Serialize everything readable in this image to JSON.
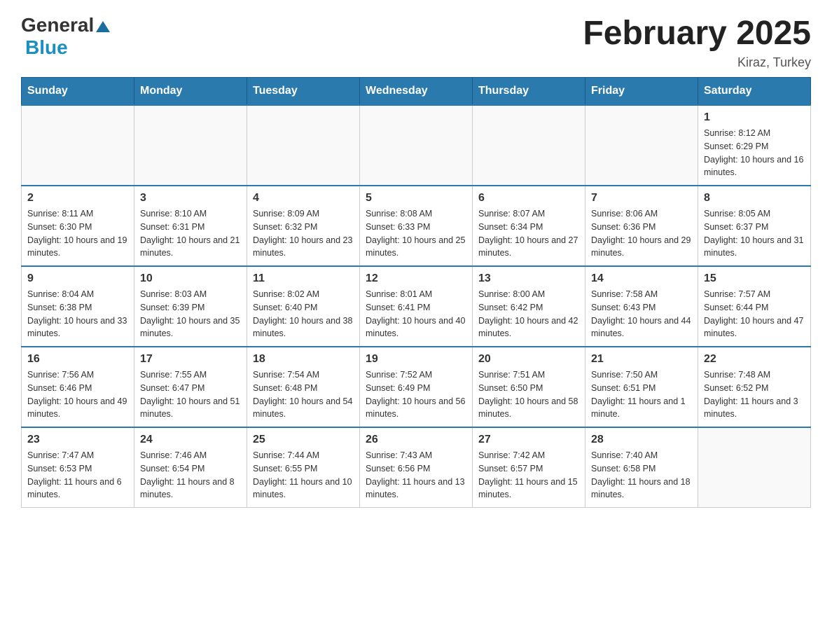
{
  "logo": {
    "general": "General",
    "triangle": "▶",
    "blue": "Blue"
  },
  "title": "February 2025",
  "location": "Kiraz, Turkey",
  "days_of_week": [
    "Sunday",
    "Monday",
    "Tuesday",
    "Wednesday",
    "Thursday",
    "Friday",
    "Saturday"
  ],
  "weeks": [
    [
      {
        "day": "",
        "info": ""
      },
      {
        "day": "",
        "info": ""
      },
      {
        "day": "",
        "info": ""
      },
      {
        "day": "",
        "info": ""
      },
      {
        "day": "",
        "info": ""
      },
      {
        "day": "",
        "info": ""
      },
      {
        "day": "1",
        "info": "Sunrise: 8:12 AM\nSunset: 6:29 PM\nDaylight: 10 hours and 16 minutes."
      }
    ],
    [
      {
        "day": "2",
        "info": "Sunrise: 8:11 AM\nSunset: 6:30 PM\nDaylight: 10 hours and 19 minutes."
      },
      {
        "day": "3",
        "info": "Sunrise: 8:10 AM\nSunset: 6:31 PM\nDaylight: 10 hours and 21 minutes."
      },
      {
        "day": "4",
        "info": "Sunrise: 8:09 AM\nSunset: 6:32 PM\nDaylight: 10 hours and 23 minutes."
      },
      {
        "day": "5",
        "info": "Sunrise: 8:08 AM\nSunset: 6:33 PM\nDaylight: 10 hours and 25 minutes."
      },
      {
        "day": "6",
        "info": "Sunrise: 8:07 AM\nSunset: 6:34 PM\nDaylight: 10 hours and 27 minutes."
      },
      {
        "day": "7",
        "info": "Sunrise: 8:06 AM\nSunset: 6:36 PM\nDaylight: 10 hours and 29 minutes."
      },
      {
        "day": "8",
        "info": "Sunrise: 8:05 AM\nSunset: 6:37 PM\nDaylight: 10 hours and 31 minutes."
      }
    ],
    [
      {
        "day": "9",
        "info": "Sunrise: 8:04 AM\nSunset: 6:38 PM\nDaylight: 10 hours and 33 minutes."
      },
      {
        "day": "10",
        "info": "Sunrise: 8:03 AM\nSunset: 6:39 PM\nDaylight: 10 hours and 35 minutes."
      },
      {
        "day": "11",
        "info": "Sunrise: 8:02 AM\nSunset: 6:40 PM\nDaylight: 10 hours and 38 minutes."
      },
      {
        "day": "12",
        "info": "Sunrise: 8:01 AM\nSunset: 6:41 PM\nDaylight: 10 hours and 40 minutes."
      },
      {
        "day": "13",
        "info": "Sunrise: 8:00 AM\nSunset: 6:42 PM\nDaylight: 10 hours and 42 minutes."
      },
      {
        "day": "14",
        "info": "Sunrise: 7:58 AM\nSunset: 6:43 PM\nDaylight: 10 hours and 44 minutes."
      },
      {
        "day": "15",
        "info": "Sunrise: 7:57 AM\nSunset: 6:44 PM\nDaylight: 10 hours and 47 minutes."
      }
    ],
    [
      {
        "day": "16",
        "info": "Sunrise: 7:56 AM\nSunset: 6:46 PM\nDaylight: 10 hours and 49 minutes."
      },
      {
        "day": "17",
        "info": "Sunrise: 7:55 AM\nSunset: 6:47 PM\nDaylight: 10 hours and 51 minutes."
      },
      {
        "day": "18",
        "info": "Sunrise: 7:54 AM\nSunset: 6:48 PM\nDaylight: 10 hours and 54 minutes."
      },
      {
        "day": "19",
        "info": "Sunrise: 7:52 AM\nSunset: 6:49 PM\nDaylight: 10 hours and 56 minutes."
      },
      {
        "day": "20",
        "info": "Sunrise: 7:51 AM\nSunset: 6:50 PM\nDaylight: 10 hours and 58 minutes."
      },
      {
        "day": "21",
        "info": "Sunrise: 7:50 AM\nSunset: 6:51 PM\nDaylight: 11 hours and 1 minute."
      },
      {
        "day": "22",
        "info": "Sunrise: 7:48 AM\nSunset: 6:52 PM\nDaylight: 11 hours and 3 minutes."
      }
    ],
    [
      {
        "day": "23",
        "info": "Sunrise: 7:47 AM\nSunset: 6:53 PM\nDaylight: 11 hours and 6 minutes."
      },
      {
        "day": "24",
        "info": "Sunrise: 7:46 AM\nSunset: 6:54 PM\nDaylight: 11 hours and 8 minutes."
      },
      {
        "day": "25",
        "info": "Sunrise: 7:44 AM\nSunset: 6:55 PM\nDaylight: 11 hours and 10 minutes."
      },
      {
        "day": "26",
        "info": "Sunrise: 7:43 AM\nSunset: 6:56 PM\nDaylight: 11 hours and 13 minutes."
      },
      {
        "day": "27",
        "info": "Sunrise: 7:42 AM\nSunset: 6:57 PM\nDaylight: 11 hours and 15 minutes."
      },
      {
        "day": "28",
        "info": "Sunrise: 7:40 AM\nSunset: 6:58 PM\nDaylight: 11 hours and 18 minutes."
      },
      {
        "day": "",
        "info": ""
      }
    ]
  ]
}
